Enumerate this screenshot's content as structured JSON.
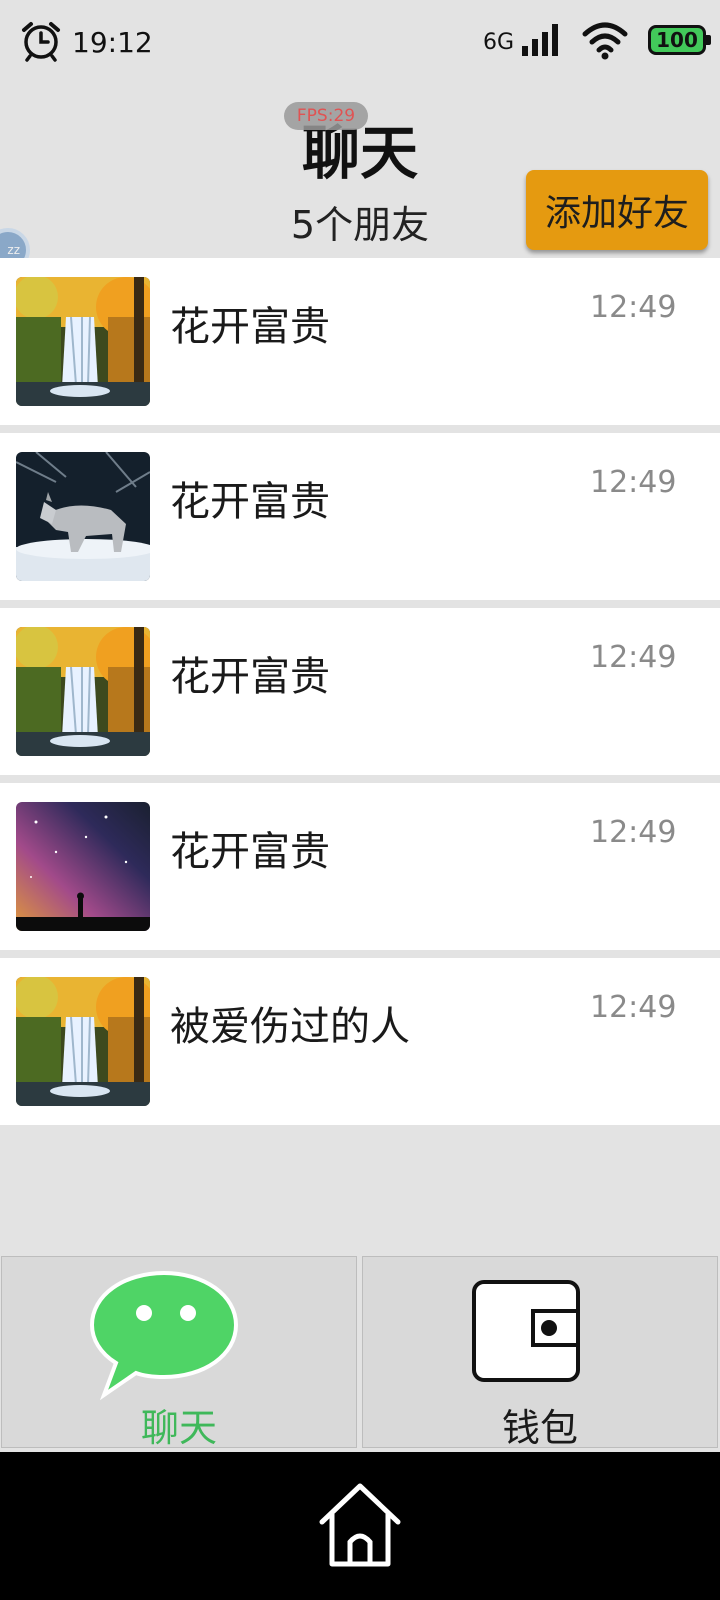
{
  "status_bar": {
    "time": "19:12",
    "network": "6G",
    "battery": "100",
    "icons": [
      "alarm-icon",
      "signal-icon",
      "wifi-icon",
      "battery-icon"
    ]
  },
  "header": {
    "fps_badge": "FPS:29",
    "title": "聊天",
    "friends_count": "5个朋友",
    "add_friend_label": "添加好友",
    "accent_color": "#e59a10"
  },
  "chats": [
    {
      "name": "花开富贵",
      "time": "12:49",
      "avatar": "waterfall-avatar"
    },
    {
      "name": "花开富贵",
      "time": "12:49",
      "avatar": "wolf-avatar"
    },
    {
      "name": "花开富贵",
      "time": "12:49",
      "avatar": "waterfall-avatar"
    },
    {
      "name": "花开富贵",
      "time": "12:49",
      "avatar": "galaxy-avatar"
    },
    {
      "name": "被爱伤过的人",
      "time": "12:49",
      "avatar": "waterfall-avatar"
    }
  ],
  "tabs": [
    {
      "label": "聊天",
      "icon": "chat-bubble-icon",
      "active": true,
      "color": "#3fb85a"
    },
    {
      "label": "钱包",
      "icon": "wallet-icon",
      "active": false,
      "color": "#1a1a1a"
    }
  ],
  "nav": {
    "icon": "home-icon"
  }
}
